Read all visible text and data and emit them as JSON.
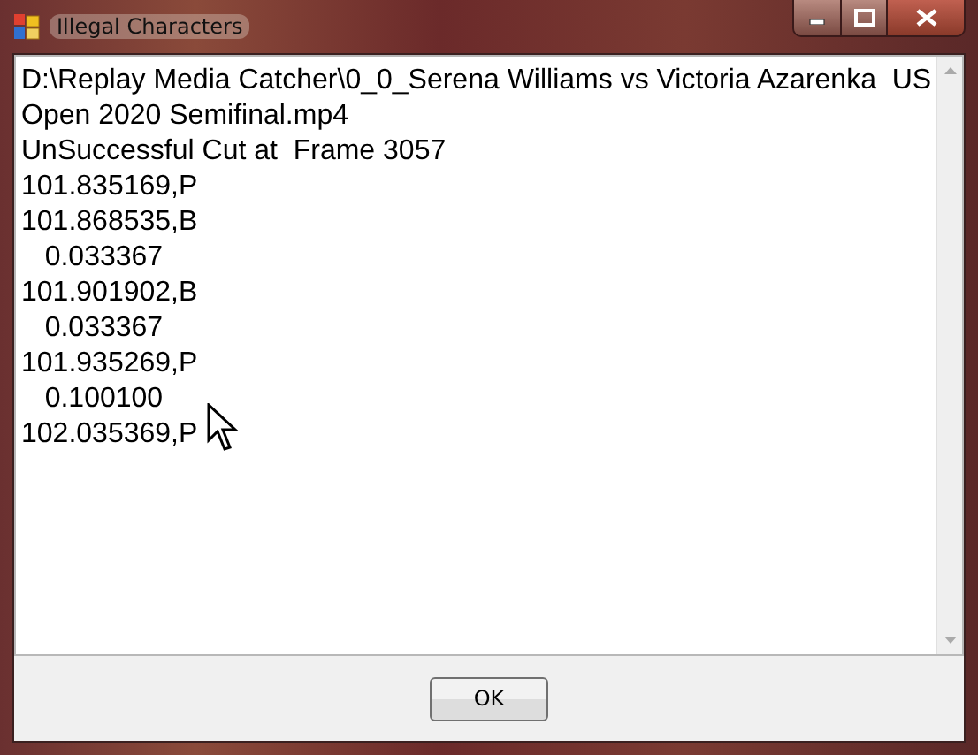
{
  "window": {
    "title": "Illegal Characters"
  },
  "message_lines": [
    "D:\\Replay Media Catcher\\0_0_Serena Williams vs Victoria Azarenka  US",
    "Open 2020 Semifinal.mp4",
    "UnSuccessful Cut at  Frame 3057",
    "101.835169,P",
    "101.868535,B",
    "   0.033367",
    "101.901902,B",
    "   0.033367",
    "101.935269,P",
    "   0.100100",
    "102.035369,P"
  ],
  "buttons": [
    "OK"
  ]
}
